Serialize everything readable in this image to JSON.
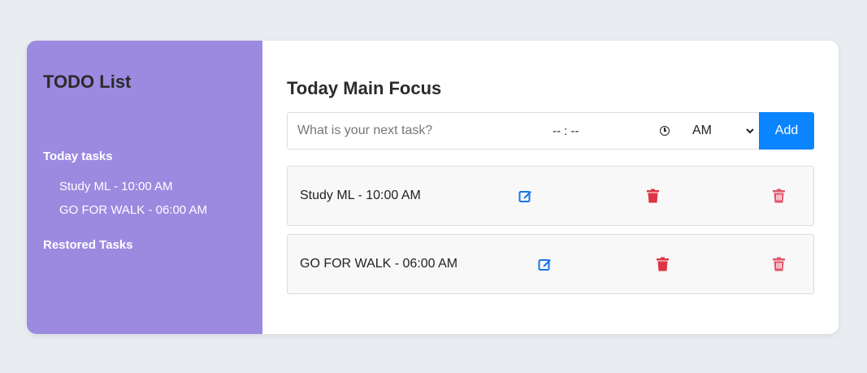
{
  "sidebar": {
    "title": "TODO List",
    "today_label": "Today tasks",
    "today_items": [
      "Study ML - 10:00 AM",
      "GO FOR WALK - 06:00 AM"
    ],
    "restored_label": "Restored Tasks"
  },
  "main": {
    "title": "Today Main Focus",
    "input_placeholder": "What is your next task?",
    "time_placeholder": "-- : --",
    "ampm_selected": "AM",
    "add_label": "Add",
    "tasks": [
      {
        "text": "Study ML - 10:00 AM"
      },
      {
        "text": "GO FOR WALK - 06:00 AM"
      }
    ]
  },
  "colors": {
    "sidebar_bg": "#9b8ae0",
    "add_button": "#0a84ff",
    "edit_icon": "#1a73e8",
    "delete_icon": "#dc3545",
    "delete_outline_icon": "#e0566a"
  },
  "icons": {
    "edit": "edit-icon",
    "delete": "trash-icon",
    "delete_outline": "trash-outline-icon",
    "time": "clock-icon",
    "dropdown": "chevron-down-icon"
  }
}
